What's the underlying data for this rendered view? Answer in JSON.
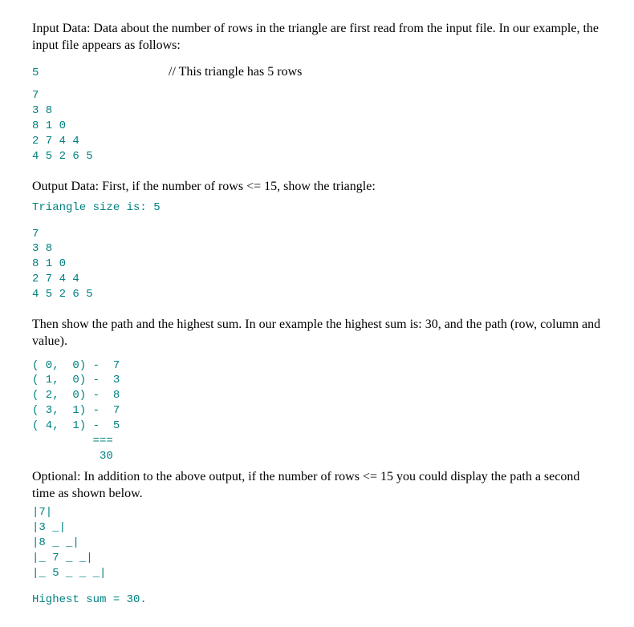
{
  "section1": {
    "intro": "Input Data: Data about the number of rows in the triangle are first read from the input file. In our example, the input file appears as follows:",
    "first_value": "5",
    "comment": "// This triangle has 5 rows",
    "input_block": "7\n3 8\n8 1 0\n2 7 4 4\n4 5 2 6 5"
  },
  "section2": {
    "intro": "Output Data: First, if the number of rows <= 15, show the triangle:",
    "header": "Triangle size is: 5",
    "triangle": "7\n3 8\n8 1 0\n2 7 4 4\n4 5 2 6 5"
  },
  "section3": {
    "intro": "Then show the path and the highest sum. In our example the highest sum is: 30, and the path (row, column and value).",
    "path": "( 0,  0) -  7\n( 1,  0) -  3\n( 2,  0) -  8\n( 3,  1) -  7\n( 4,  1) -  5\n         ===\n          30"
  },
  "section4": {
    "intro": "Optional: In addition to the above output, if the number of rows <= 15 you could display the path a second time as shown below.",
    "display": "|7|\n|3 _|\n|8 _ _|\n|_ 7 _ _|\n|_ 5 _ _ _|",
    "footer": "Highest sum = 30."
  }
}
